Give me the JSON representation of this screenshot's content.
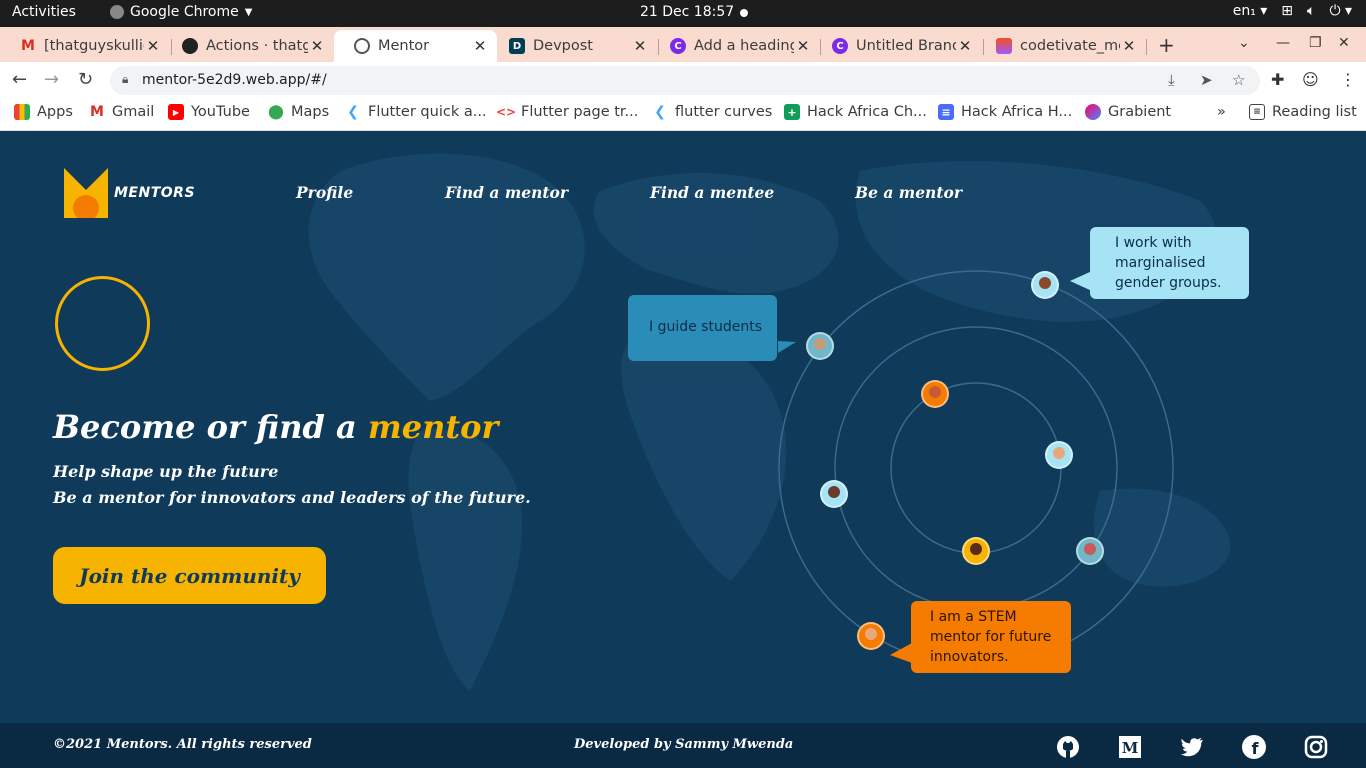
{
  "system_bar": {
    "activities": "Activities",
    "app_name": "Google Chrome",
    "clock": "21 Dec  18:57",
    "lang": "en₁"
  },
  "tabs": [
    {
      "title": "[thatguyskullie",
      "icon": "gmail-icon"
    },
    {
      "title": "Actions · thatg",
      "icon": "github-icon"
    },
    {
      "title": "Mentor",
      "icon": "globe-icon"
    },
    {
      "title": "Devpost",
      "icon": "devpost-icon"
    },
    {
      "title": "Add a heading",
      "icon": "canva-icon"
    },
    {
      "title": "Untitled Brand",
      "icon": "canva-icon"
    },
    {
      "title": "codetivate_me",
      "icon": "figma-icon"
    }
  ],
  "address": {
    "url": "mentor-5e2d9.web.app/#/"
  },
  "bookmarks": [
    {
      "label": "Apps"
    },
    {
      "label": "Gmail"
    },
    {
      "label": "YouTube"
    },
    {
      "label": "Maps"
    },
    {
      "label": "Flutter quick a..."
    },
    {
      "label": "Flutter page tr..."
    },
    {
      "label": "flutter curves"
    },
    {
      "label": "Hack Africa Ch..."
    },
    {
      "label": "Hack Africa H..."
    },
    {
      "label": "Grabient"
    }
  ],
  "reading_list": "Reading list",
  "site": {
    "logo_text": "MENTORS",
    "nav": [
      "Profile",
      "Find a mentor",
      "Find a mentee",
      "Be a mentor"
    ],
    "hero_title_prefix": "Become or find a ",
    "hero_title_accent": "mentor",
    "hero_sub_1": "Help shape up the future",
    "hero_sub_2": "Be a mentor for  innovators and leaders  of the future.",
    "cta": "Join the community",
    "bubbles": [
      "I guide students",
      "I work with marginalised gender groups.",
      "I  am a STEM mentor for future innovators."
    ]
  },
  "footer": {
    "copyright": "©2021 Mentors. All rights reserved",
    "developer": "Developed by Sammy Mwenda"
  },
  "colors": {
    "background": "#0f3a5a",
    "accent": "#f6b400",
    "bubble_blue": "#2a8db8",
    "bubble_light": "#a6e3f5",
    "bubble_orange": "#f57c00"
  }
}
